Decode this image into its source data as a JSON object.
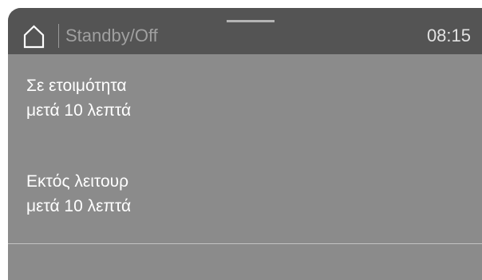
{
  "header": {
    "icon": "home-icon",
    "title": "Standby/Off",
    "time": "08:15"
  },
  "options": [
    {
      "line1": "Σε ετοιμότητα",
      "line2": "μετά 10 λεπτά"
    },
    {
      "line1": "Εκτός λειτουρ",
      "line2": "μετά 10 λεπτά"
    }
  ],
  "colors": {
    "header_bg": "#545454",
    "screen_bg": "#8b8b8b",
    "text": "#ffffff"
  }
}
